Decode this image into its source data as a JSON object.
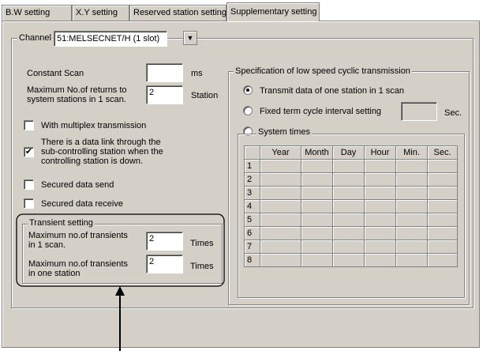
{
  "tabs": [
    {
      "label": "B.W setting"
    },
    {
      "label": "X.Y setting"
    },
    {
      "label": "Reserved station setting"
    },
    {
      "label": "Supplementary setting"
    }
  ],
  "channel": {
    "label": "Channel",
    "value": "51:MELSECNET/H (1 slot)"
  },
  "constant_scan": {
    "label": "Constant Scan",
    "value": "",
    "unit": "ms"
  },
  "max_returns": {
    "label_line1": "Maximum No.of returns to",
    "label_line2": "system stations in 1 scan.",
    "value": "2",
    "unit": "Station"
  },
  "checkboxes": {
    "multiplex": {
      "label": "With multiplex transmission",
      "checked": false
    },
    "data_link": {
      "line1": "There is a data link through the",
      "line2": "sub-controlling station when the",
      "line3": "controlling station is down.",
      "checked": true,
      "mark": "✔"
    },
    "secured_send": {
      "label": "Secured data send",
      "checked": false
    },
    "secured_receive": {
      "label": "Secured data receive",
      "checked": false
    }
  },
  "transient": {
    "title": "Transient setting",
    "scan": {
      "line1": "Maximum no.of transients",
      "line2": "in 1 scan.",
      "value": "2",
      "unit": "Times"
    },
    "station": {
      "line1": "Maximum no.of transients",
      "line2": "in one station",
      "value": "2",
      "unit": "Times"
    }
  },
  "low_speed": {
    "title": "Specification of low speed cyclic transmission",
    "option_one": {
      "label": "Transmit data of one station in 1 scan",
      "selected": true
    },
    "option_fixed": {
      "label": "Fixed term cycle interval setting",
      "value": "",
      "unit": "Sec."
    },
    "option_system": {
      "label": "System times"
    },
    "columns": [
      "Year",
      "Month",
      "Day",
      "Hour",
      "Min.",
      "Sec."
    ],
    "rows": [
      "1",
      "2",
      "3",
      "4",
      "5",
      "6",
      "7",
      "8"
    ]
  }
}
